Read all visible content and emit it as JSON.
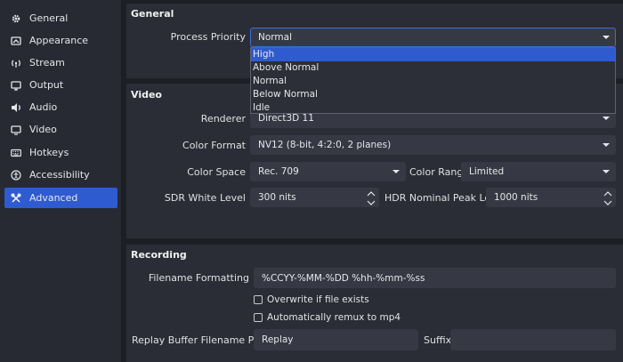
{
  "sidebar": {
    "items": [
      {
        "label": "General",
        "icon": "gear-icon"
      },
      {
        "label": "Appearance",
        "icon": "appearance-icon"
      },
      {
        "label": "Stream",
        "icon": "antenna-icon"
      },
      {
        "label": "Output",
        "icon": "output-icon"
      },
      {
        "label": "Audio",
        "icon": "speaker-icon"
      },
      {
        "label": "Video",
        "icon": "monitor-icon"
      },
      {
        "label": "Hotkeys",
        "icon": "keyboard-icon"
      },
      {
        "label": "Accessibility",
        "icon": "accessibility-icon"
      },
      {
        "label": "Advanced",
        "icon": "tools-icon",
        "active": true
      }
    ]
  },
  "general": {
    "title": "General",
    "process_priority_label": "Process Priority",
    "process_priority_value": "Normal",
    "options": [
      "High",
      "Above Normal",
      "Normal",
      "Below Normal",
      "Idle"
    ],
    "highlighted": "High"
  },
  "video": {
    "title": "Video",
    "renderer_label": "Renderer",
    "renderer_value": "Direct3D 11",
    "color_format_label": "Color Format",
    "color_format_value": "NV12 (8-bit, 4:2:0, 2 planes)",
    "color_space_label": "Color Space",
    "color_space_value": "Rec. 709",
    "color_range_label": "Color Range",
    "color_range_value": "Limited",
    "sdr_label": "SDR White Level",
    "sdr_value": "300 nits",
    "hdr_label": "HDR Nominal Peak Level",
    "hdr_value": "1000 nits"
  },
  "recording": {
    "title": "Recording",
    "filename_label": "Filename Formatting",
    "filename_value": "%CCYY-%MM-%DD %hh-%mm-%ss",
    "overwrite_label": "Overwrite if file exists",
    "remux_label": "Automatically remux to mp4",
    "replay_label": "Replay Buffer Filename Prefix",
    "replay_value": "Replay",
    "suffix_label": "Suffix",
    "suffix_value": ""
  },
  "colors": {
    "accent": "#2f5bd0",
    "panel": "#2a2d35",
    "field": "#363944",
    "background": "#1d1f26"
  }
}
